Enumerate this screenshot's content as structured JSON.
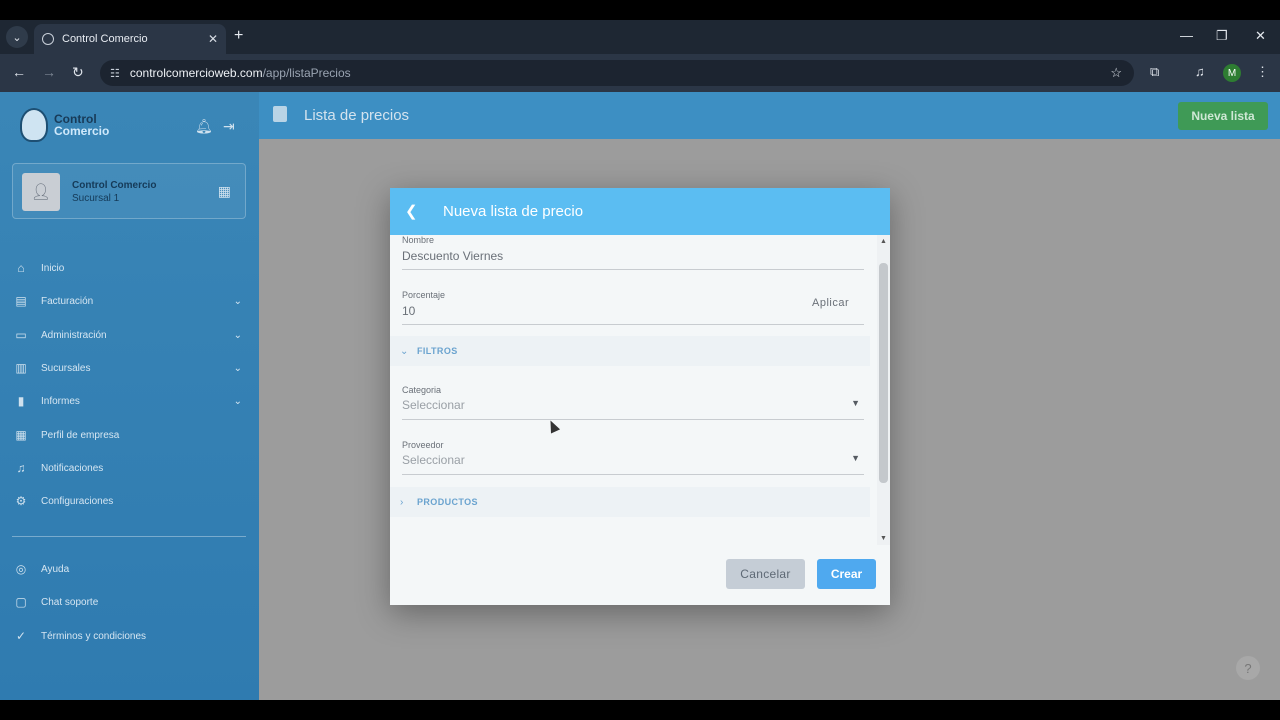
{
  "browser": {
    "tab_title": "Control Comercio",
    "tab_close": "✕",
    "new_tab": "+",
    "url_host": "controlcomercioweb.com",
    "url_path": "/app/listaPrecios",
    "profile_initial": "M"
  },
  "sidebar": {
    "logo_line1": "Control",
    "logo_line2": "Comercio",
    "user_name": "Control Comercio",
    "user_branch": "Sucursal 1",
    "menu": [
      {
        "label": "Inicio",
        "icon": "home-icon"
      },
      {
        "label": "Facturación",
        "icon": "invoice-icon",
        "expandable": true
      },
      {
        "label": "Administración",
        "icon": "folder-icon",
        "expandable": true
      },
      {
        "label": "Sucursales",
        "icon": "store-icon",
        "expandable": true
      },
      {
        "label": "Informes",
        "icon": "bar-chart-icon",
        "expandable": true
      },
      {
        "label": "Perfil de empresa",
        "icon": "building-icon"
      },
      {
        "label": "Notificaciones",
        "icon": "bell-icon"
      },
      {
        "label": "Configuraciones",
        "icon": "gear-icon"
      }
    ],
    "secondary_menu": [
      {
        "label": "Ayuda",
        "icon": "help-icon"
      },
      {
        "label": "Chat soporte",
        "icon": "chat-icon"
      },
      {
        "label": "Términos y condiciones",
        "icon": "check-circle-icon"
      }
    ]
  },
  "header": {
    "title": "Lista de precios",
    "new_list_button": "Nueva lista"
  },
  "dialog": {
    "title": "Nueva lista de precio",
    "name_label": "Nombre",
    "name_value": "Descuento Viernes",
    "percent_label": "Porcentaje",
    "percent_value": "10",
    "apply_label": "Aplicar",
    "filters_section": "FILTROS",
    "category_label": "Categoria",
    "category_placeholder": "Seleccionar",
    "supplier_label": "Proveedor",
    "supplier_placeholder": "Seleccionar",
    "products_section": "PRODUCTOS",
    "cancel_button": "Cancelar",
    "create_button": "Crear"
  },
  "help_button": "?",
  "colors": {
    "sidebar": "#3a86b7",
    "dialog_header": "#5bbdf2",
    "primary_button": "#4fa9ef",
    "new_list_button": "#3f9a56"
  }
}
